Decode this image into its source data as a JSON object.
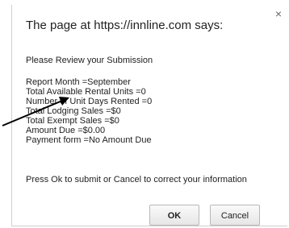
{
  "dialog": {
    "title": "The page at https://innline.com says:",
    "close_glyph": "×",
    "intro": "Please Review your Submission",
    "details": [
      "Report Month =September",
      "Total Available Rental Units =0",
      "Number of Unit Days Rented =0",
      "Total Lodging Sales =$0",
      "Total Exempt Sales =$0",
      "Amount Due =$0.00",
      "Payment form =No Amount Due"
    ],
    "footer": "Press Ok to submit or Cancel to correct your information",
    "ok_label": "OK",
    "cancel_label": "Cancel"
  },
  "annotation": {
    "icon": "arrow-icon",
    "color": "#000000"
  }
}
